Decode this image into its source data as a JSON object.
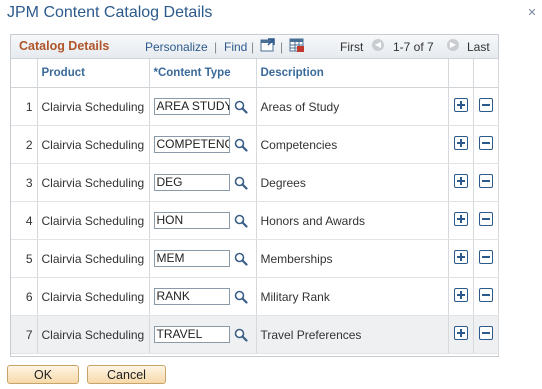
{
  "window": {
    "title": "JPM Content Catalog Details",
    "close_label": "✕"
  },
  "grid": {
    "title": "Catalog Details",
    "personalize": "Personalize",
    "divider": "|",
    "find": "Find",
    "nav_first": "First",
    "nav_range": "1-7 of 7",
    "nav_last": "Last",
    "columns": {
      "product": "Product",
      "content_type": "*Content Type",
      "description": "Description"
    },
    "rows": [
      {
        "num": "1",
        "product": "Clairvia Scheduling",
        "content_type": "AREA STUDY",
        "description": "Areas of Study"
      },
      {
        "num": "2",
        "product": "Clairvia Scheduling",
        "content_type": "COMPETENCY",
        "description": "Competencies"
      },
      {
        "num": "3",
        "product": "Clairvia Scheduling",
        "content_type": "DEG",
        "description": "Degrees"
      },
      {
        "num": "4",
        "product": "Clairvia Scheduling",
        "content_type": "HON",
        "description": "Honors and Awards"
      },
      {
        "num": "5",
        "product": "Clairvia Scheduling",
        "content_type": "MEM",
        "description": "Memberships"
      },
      {
        "num": "6",
        "product": "Clairvia Scheduling",
        "content_type": "RANK",
        "description": "Military Rank"
      },
      {
        "num": "7",
        "product": "Clairvia Scheduling",
        "content_type": "TRAVEL",
        "description": "Travel Preferences"
      }
    ]
  },
  "buttons": {
    "ok": "OK",
    "cancel": "Cancel"
  }
}
